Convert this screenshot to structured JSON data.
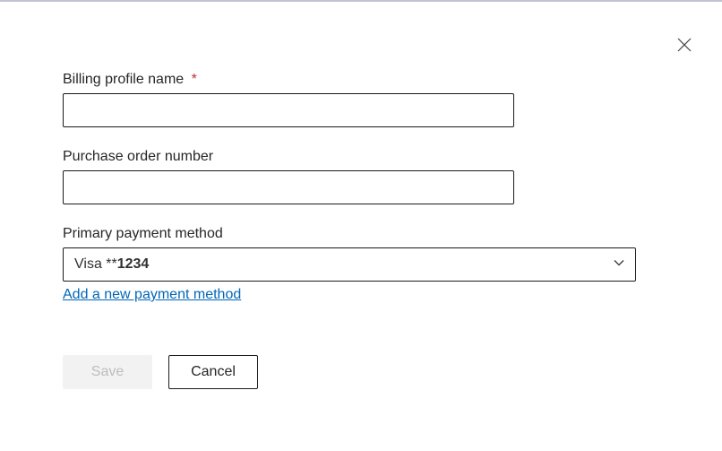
{
  "fields": {
    "billingProfile": {
      "label": "Billing profile name",
      "value": "",
      "required": true
    },
    "purchaseOrder": {
      "label": "Purchase order number",
      "value": ""
    },
    "paymentMethod": {
      "label": "Primary payment method",
      "selected_prefix": "Visa **",
      "selected_suffix": "1234"
    }
  },
  "links": {
    "addPayment": "Add a new payment method"
  },
  "buttons": {
    "save": "Save",
    "cancel": "Cancel"
  },
  "requiredMark": "*"
}
